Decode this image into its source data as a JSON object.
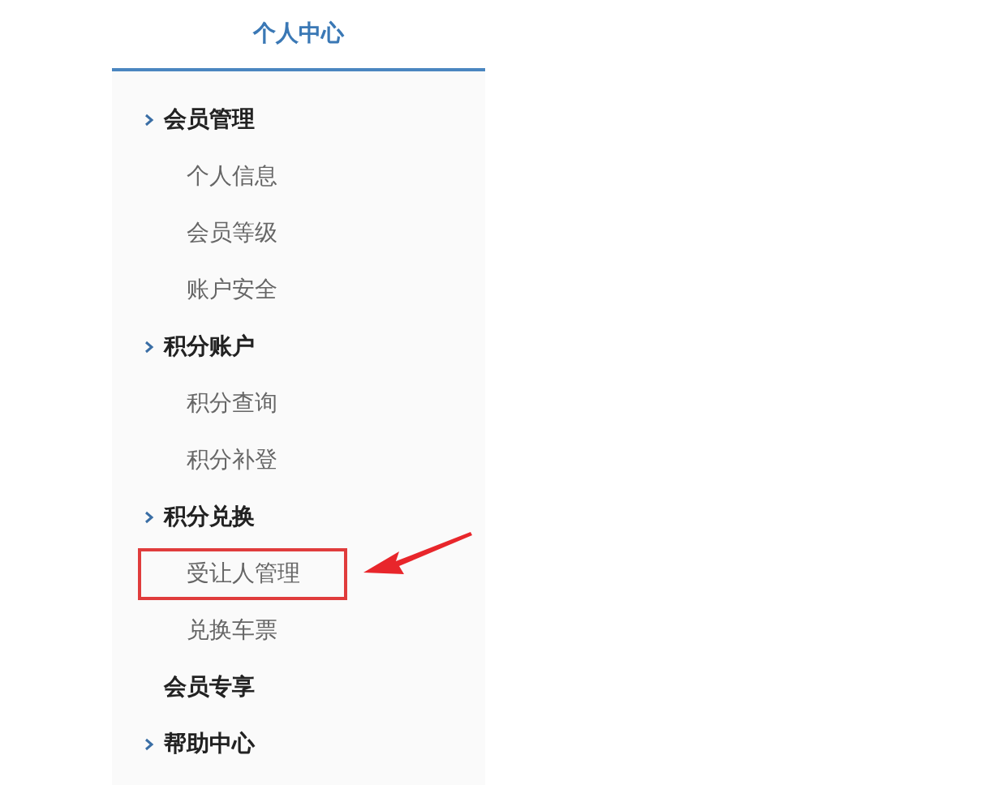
{
  "sidebar": {
    "title": "个人中心",
    "groups": [
      {
        "label": "会员管理",
        "expandable": true,
        "children": [
          {
            "label": "个人信息",
            "annotated": false
          },
          {
            "label": "会员等级",
            "annotated": false
          },
          {
            "label": "账户安全",
            "annotated": false
          }
        ]
      },
      {
        "label": "积分账户",
        "expandable": true,
        "children": [
          {
            "label": "积分查询",
            "annotated": false
          },
          {
            "label": "积分补登",
            "annotated": false
          }
        ]
      },
      {
        "label": "积分兑换",
        "expandable": true,
        "children": [
          {
            "label": "受让人管理",
            "annotated": true
          },
          {
            "label": "兑换车票",
            "annotated": false
          }
        ]
      },
      {
        "label": "会员专享",
        "expandable": false
      },
      {
        "label": "帮助中心",
        "expandable": true
      }
    ]
  }
}
